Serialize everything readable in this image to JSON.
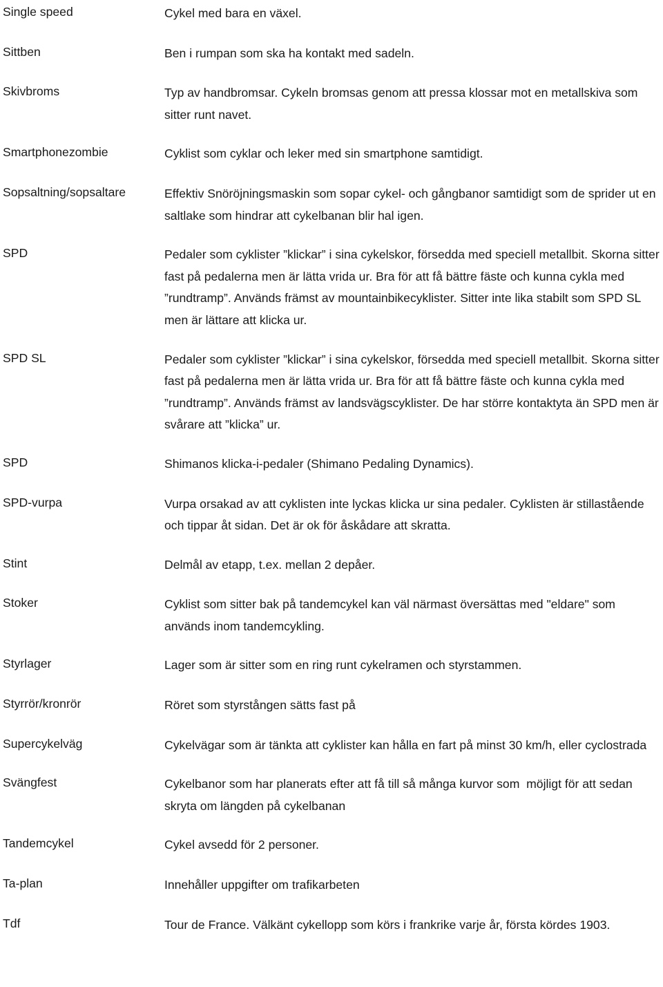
{
  "document": {
    "type": "glossary",
    "language": "sv",
    "columns": [
      "term",
      "definition"
    ]
  },
  "entries": [
    {
      "term": "Single speed",
      "definition": "Cykel med bara en växel."
    },
    {
      "term": "Sittben",
      "definition": "Ben i rumpan som ska ha kontakt med sadeln."
    },
    {
      "term": "Skivbroms",
      "definition": "Typ av handbromsar. Cykeln bromsas genom att pressa klossar mot en metallskiva som sitter runt navet."
    },
    {
      "term": "Smartphonezombie",
      "definition": "Cyklist som cyklar och leker med sin smartphone samtidigt."
    },
    {
      "term": "Sopsaltning/sopsaltare",
      "definition": "Effektiv Snöröjningsmaskin som sopar cykel- och gångbanor samtidigt som de sprider ut en saltlake som hindrar att cykelbanan blir hal igen."
    },
    {
      "term": "SPD",
      "definition": "Pedaler som cyklister ”klickar” i sina cykelskor, försedda med speciell metallbit. Skorna sitter fast på pedalerna men är lätta vrida ur. Bra för att få bättre fäste och kunna cykla med ”rundtramp”. Används främst av mountainbikecyklister. Sitter inte lika stabilt som SPD SL men är lättare att klicka ur."
    },
    {
      "term": "SPD SL",
      "definition": "Pedaler som cyklister ”klickar” i sina cykelskor, försedda med speciell metallbit. Skorna sitter fast på pedalerna men är lätta vrida ur. Bra för att få bättre fäste och kunna cykla med ”rundtramp”. Används främst av landsvägscyklister. De har större kontaktyta än SPD men är svårare att ”klicka” ur."
    },
    {
      "term": "SPD",
      "definition": "Shimanos klicka-i-pedaler (Shimano Pedaling Dynamics)."
    },
    {
      "term": "SPD-vurpa",
      "definition": "Vurpa orsakad av att cyklisten inte lyckas klicka ur sina pedaler. Cyklisten är stillastående och tippar åt sidan. Det är ok för åskådare att skratta."
    },
    {
      "term": "Stint",
      "definition": "Delmål av etapp, t.ex. mellan 2 depåer."
    },
    {
      "term": "Stoker",
      "definition": "Cyklist som sitter bak på tandemcykel kan väl närmast översättas med \"eldare\" som används inom tandemcykling."
    },
    {
      "term": "Styrlager",
      "definition": "Lager som är sitter som en ring runt cykelramen och styrstammen."
    },
    {
      "term": "Styrrör/kronrör",
      "definition": "Röret som styrstången sätts fast på"
    },
    {
      "term": "Supercykelväg",
      "definition": "Cykelvägar som är tänkta att cyklister kan hålla en fart på minst 30 km/h, eller cyclostrada"
    },
    {
      "term": "Svängfest",
      "definition": "Cykelbanor som har planerats efter att få till så många kurvor som  möjligt för att sedan skryta om längden på cykelbanan"
    },
    {
      "term": "Tandemcykel",
      "definition": "Cykel avsedd för 2 personer."
    },
    {
      "term": "Ta-plan",
      "definition": "Innehåller uppgifter om trafikarbeten"
    },
    {
      "term": "Tdf",
      "definition": "Tour de France. Välkänt cykellopp som körs i frankrike varje år, första kördes 1903."
    }
  ]
}
